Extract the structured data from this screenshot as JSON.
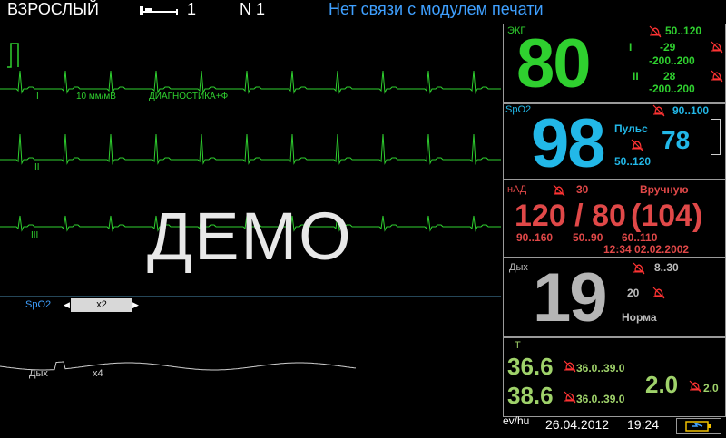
{
  "topbar": {
    "mode": "ВЗРОСЛЫЙ",
    "bed_number": "1",
    "network": "N 1",
    "warning": "Нет связи с модулем печати"
  },
  "waves": {
    "ecg_lead_top": "I",
    "ecg_scale": "10 мм/мВ",
    "ecg_mode": "ДИАГНОСТИКА+Ф",
    "ecg_lead_mid": "II",
    "ecg_lead_bot": "III",
    "spo2_label": "SpO2",
    "spo2_gain": "x2",
    "resp_label": "Дых",
    "resp_gain": "x4",
    "demo": "ДЕМО"
  },
  "ekg": {
    "title": "ЭКГ",
    "hr": "80",
    "hr_limits": "50..120",
    "st1_label": "I",
    "st1_value": "-29",
    "st1_limits": "-200..200",
    "st2_label": "II",
    "st2_value": "28",
    "st2_limits": "-200..200"
  },
  "spo2": {
    "title": "SpO2",
    "value": "98",
    "limits": "90..100",
    "pulse_label": "Пульс",
    "pulse_value": "78",
    "pulse_limits": "50..120"
  },
  "nad": {
    "title": "нАД",
    "interval": "30",
    "mode": "Вручную",
    "sys_dia": "120 / 80",
    "mean": "(104)",
    "sys_limits": "90..160",
    "dia_limits": "50..90",
    "mean_limits": "60..110",
    "timestamp": "12:34 02.02.2002"
  },
  "resp": {
    "title": "Дых",
    "value": "19",
    "limits": "8..30",
    "apnea": "20",
    "status": "Норма"
  },
  "temp": {
    "title": "Т",
    "t1": "36.6",
    "t1_limits": "36.0..39.0",
    "t2": "38.6",
    "t2_limits": "36.0..39.0",
    "dt": "2.0",
    "dt_limit": "2.0"
  },
  "status": {
    "url_fragment": "ev/hu",
    "date": "26.04.2012",
    "time": "19:24"
  },
  "colors": {
    "ecg": "#2fd02f",
    "spo2": "#22b8e8",
    "nad": "#e04848",
    "resp": "#bdbdbd",
    "temp": "#9fd26a",
    "alarm": "#ff3333",
    "warning": "#3fa0ff"
  }
}
